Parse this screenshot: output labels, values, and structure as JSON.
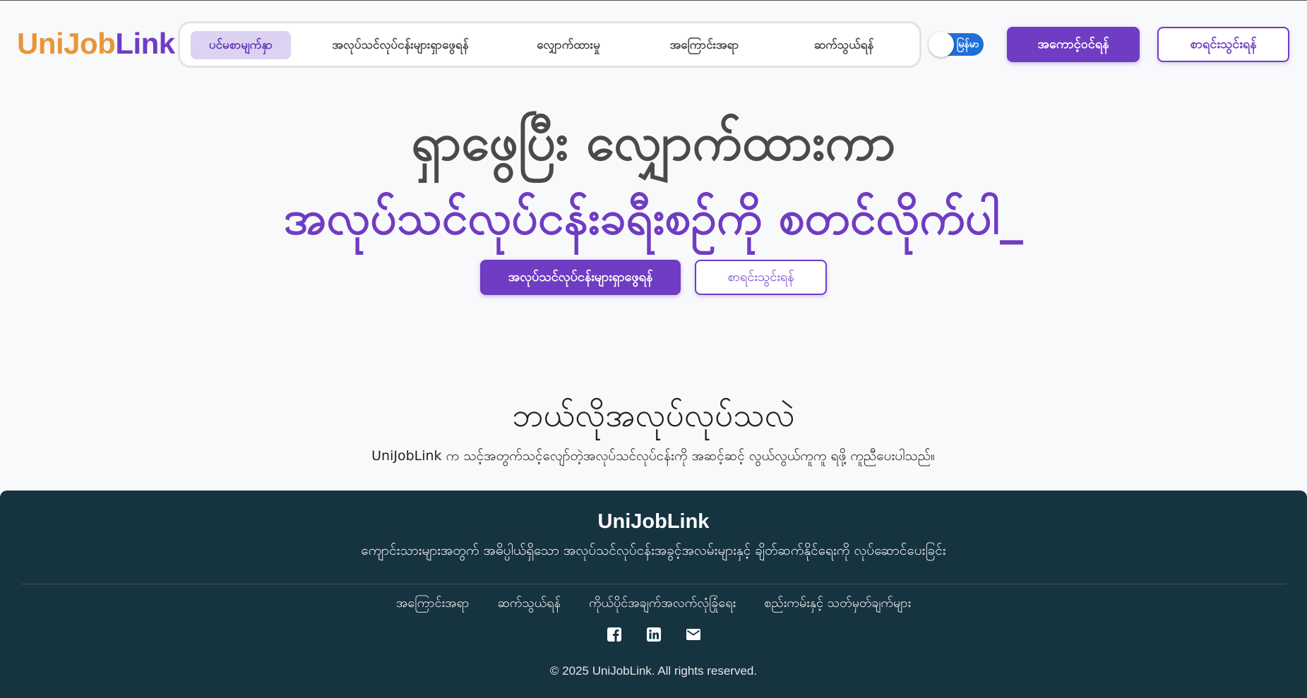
{
  "header": {
    "logo_part1": "UniJob",
    "logo_part2": "Link",
    "nav": [
      {
        "label": "ပင်မစာမျက်နှာ",
        "active": true
      },
      {
        "label": "အလုပ်သင်လုပ်ငန်းများရှာဖွေရန်",
        "active": false
      },
      {
        "label": "လျှောက်ထားမှု",
        "active": false
      },
      {
        "label": "အကြောင်းအရာ",
        "active": false
      },
      {
        "label": "ဆက်သွယ်ရန်",
        "active": false
      }
    ],
    "language_toggle": "မြန်မာ",
    "login_label": "အကောင့်ဝင်ရန်",
    "register_label": "စာရင်းသွင်းရန်"
  },
  "hero": {
    "line1": "ရှာဖွေပြီး လျှောက်ထားကာ",
    "line2": "အလုပ်သင်လုပ်ငန်းခရီးစဉ်ကို စတင်လိုက်ပါ_",
    "primary_button": "အလုပ်သင်လုပ်ငန်းများရှာဖွေရန်",
    "secondary_button": "စာရင်းသွင်းရန်"
  },
  "section": {
    "title": "ဘယ်လိုအလုပ်လုပ်သလဲ",
    "description": "UniJobLink က သင့်အတွက်သင့်လျော်တဲ့အလုပ်သင်လုပ်ငန်းကို အဆင့်ဆင့် လွယ်လွယ်ကူကူ ရဖို့ ကူညီပေးပါသည်။"
  },
  "footer": {
    "brand": "UniJobLink",
    "tagline": "ကျောင်းသားများအတွက် အဓိပ္ပါယ်ရှိသော အလုပ်သင်လုပ်ငန်းအခွင့်အလမ်းများနှင့် ချိတ်ဆက်နိုင်ရေးကို လုပ်ဆောင်ပေးခြင်း",
    "links": [
      "အကြောင်းအရာ",
      "ဆက်သွယ်ရန်",
      "ကိုယ်ပိုင်အချက်အလက်လုံခြုံရေး",
      "စည်းကမ်းနှင့် သတ်မှတ်ချက်များ"
    ],
    "icons": [
      "facebook-icon",
      "linkedin-icon",
      "email-icon"
    ],
    "copyright": "© 2025 UniJobLink. All rights reserved."
  },
  "colors": {
    "brand_purple": "#6f3cc3",
    "brand_orange": "#e8963a",
    "footer_bg": "#163340",
    "toggle_blue": "#1f6fd8"
  }
}
